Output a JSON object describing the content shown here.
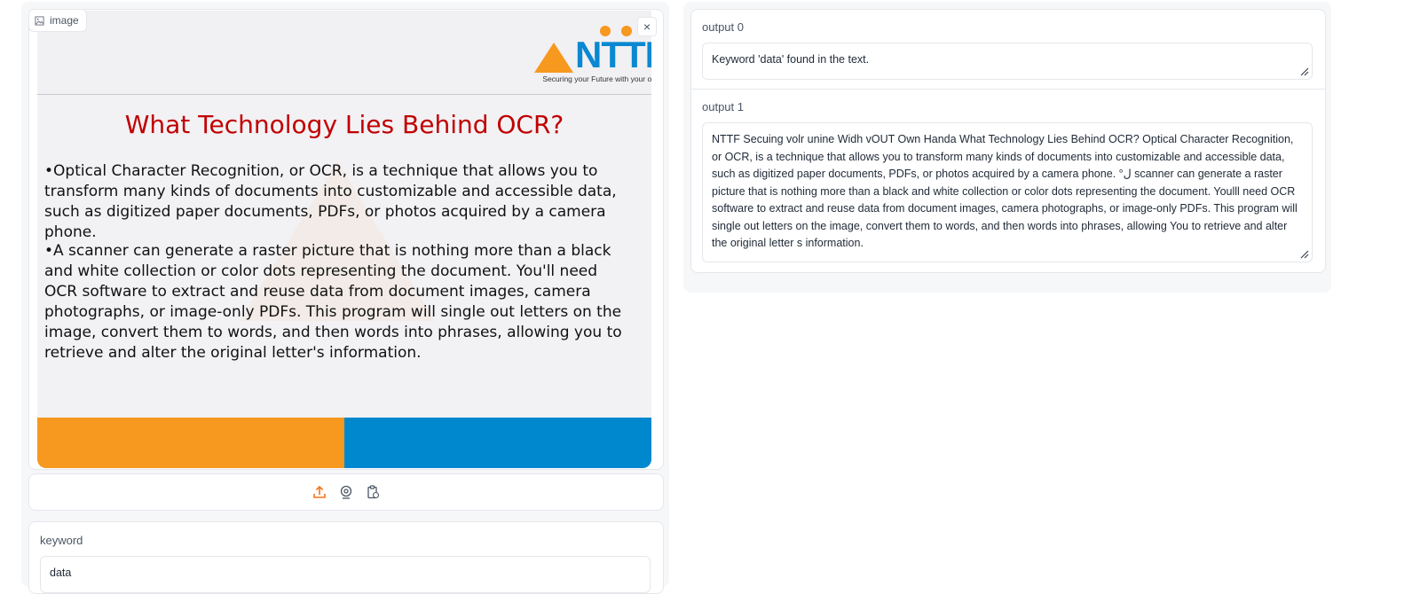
{
  "image_input": {
    "label": "image",
    "close_symbol": "×",
    "slide": {
      "logo_text": "NTTF",
      "logo_tagline": "Securing your Future with your own Hands",
      "title": "What Technology Lies Behind OCR?",
      "paragraph_1": "•Optical Character Recognition, or OCR, is a technique that allows you to transform many kinds of documents into customizable and accessible data, such as digitized paper documents, PDFs, or photos acquired by a camera phone.",
      "paragraph_2": "•A scanner can generate a raster picture that is nothing more than a black and white collection or color dots representing the document. You'll need OCR software to extract and reuse data from document images, camera photographs, or image-only PDFs. This program will single out letters on the image, convert them to words, and then words into phrases, allowing you to retrieve and alter the original letter's information.",
      "colors": {
        "title": "#c00000",
        "orange": "#f7981f",
        "blue": "#0088cf"
      }
    },
    "toolbar_icons": [
      "upload-icon",
      "webcam-icon",
      "clipboard-icon"
    ]
  },
  "keyword": {
    "label": "keyword",
    "value": "data"
  },
  "output0": {
    "label": "output 0",
    "value": "Keyword 'data' found in the text."
  },
  "output1": {
    "label": "output 1",
    "value": "NTTF Secuing volr unine Widh vOUT Own Handa What Technology Lies Behind OCR? Optical Character Recognition, or OCR, is a technique that allows you to transform many kinds of documents into customizable and accessible data, such as digitized paper documents, PDFs, or photos acquired by a camera phone. °ل scanner can generate a raster picture that is nothing more than a black and white collection or color dots representing the document. Youlll need OCR software to extract and reuse data from document images, camera photographs, or image-only PDFs. This program will single out letters on the image, convert them to words, and then words into phrases, allowing You to retrieve and alter the original letter s information."
  },
  "accent_color": "#f97316"
}
